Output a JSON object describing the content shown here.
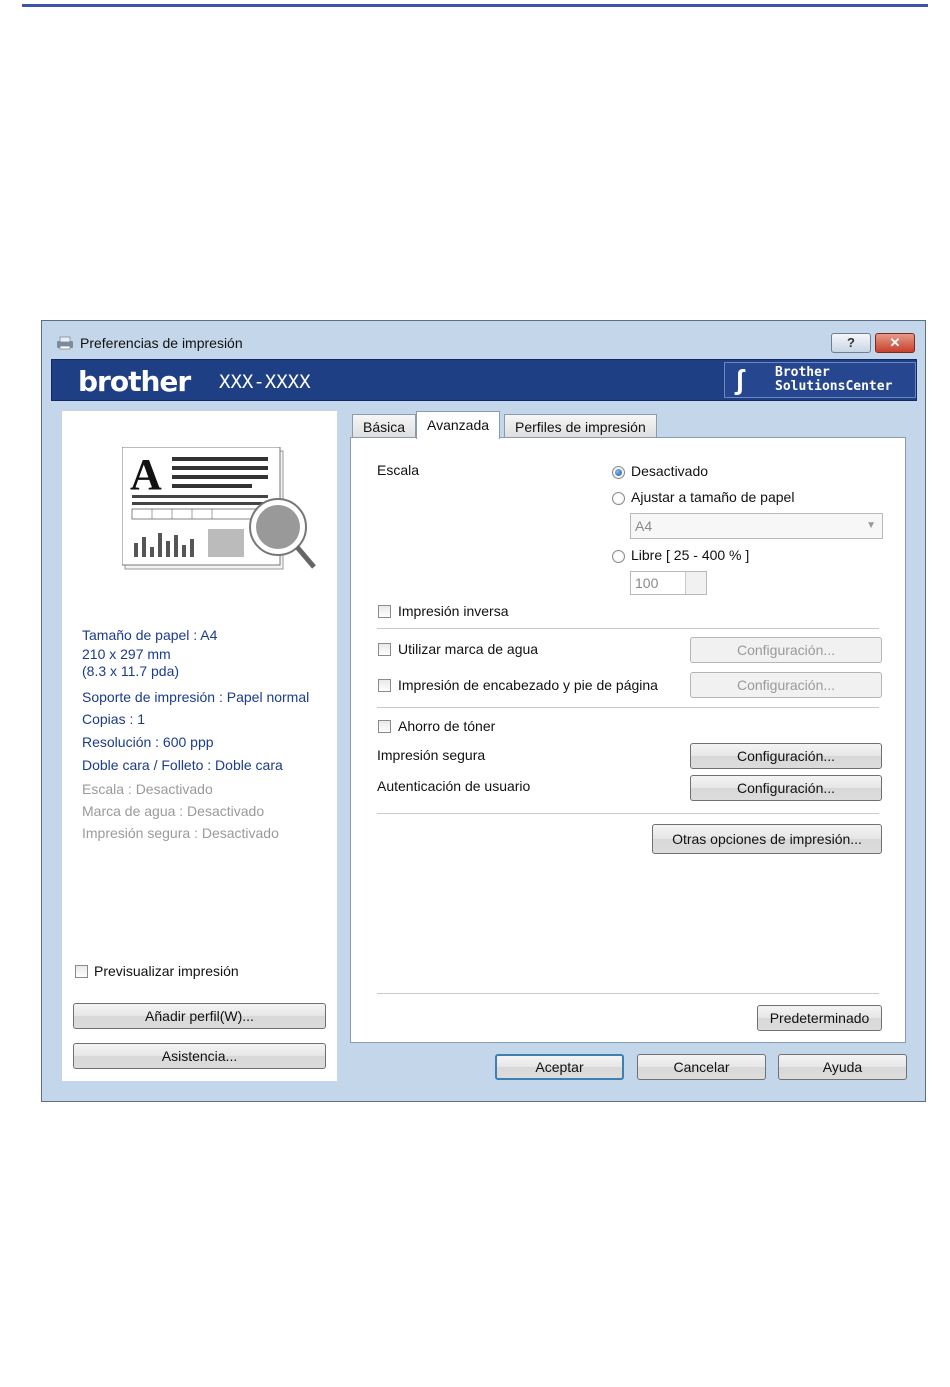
{
  "window": {
    "title": "Preferencias de impresión",
    "help_label": "?",
    "close_label": "✕"
  },
  "brand": {
    "logo": "brother",
    "model": "XXX-XXXX",
    "solutions_line1": "Brother",
    "solutions_line2": "SolutionsCenter"
  },
  "summary": {
    "paper_size": "Tamaño de papel : A4",
    "dimensions_mm": "210 x 297 mm",
    "dimensions_in": "(8.3 x 11.7 pda)",
    "media": "Soporte de impresión : Papel normal",
    "copies": "Copias : 1",
    "resolution": "Resolución : 600 ppp",
    "duplex": "Doble cara / Folleto : Doble cara",
    "scale": "Escala : Desactivado",
    "watermark": "Marca de agua : Desactivado",
    "secure": "Impresión segura : Desactivado"
  },
  "left": {
    "preview_label": "Previsualizar impresión",
    "add_profile": "Añadir perfil(W)...",
    "support": "Asistencia..."
  },
  "tabs": [
    "Básica",
    "Avanzada",
    "Perfiles de impresión"
  ],
  "advanced": {
    "scale_label": "Escala",
    "scale_off": "Desactivado",
    "scale_fit": "Ajustar a tamaño de papel",
    "paper_select": "A4",
    "scale_free": "Libre [ 25 - 400 % ]",
    "free_value": "100",
    "reverse": "Impresión inversa",
    "watermark": "Utilizar marca de agua",
    "header_footer": "Impresión de encabezado y pie de página",
    "toner_save": "Ahorro de tóner",
    "secure_print": "Impresión segura",
    "user_auth": "Autenticación de usuario",
    "config_label": "Configuración...",
    "other_options": "Otras opciones de impresión...",
    "default_button": "Predeterminado"
  },
  "footer": {
    "ok": "Aceptar",
    "cancel": "Cancelar",
    "help": "Ayuda"
  }
}
